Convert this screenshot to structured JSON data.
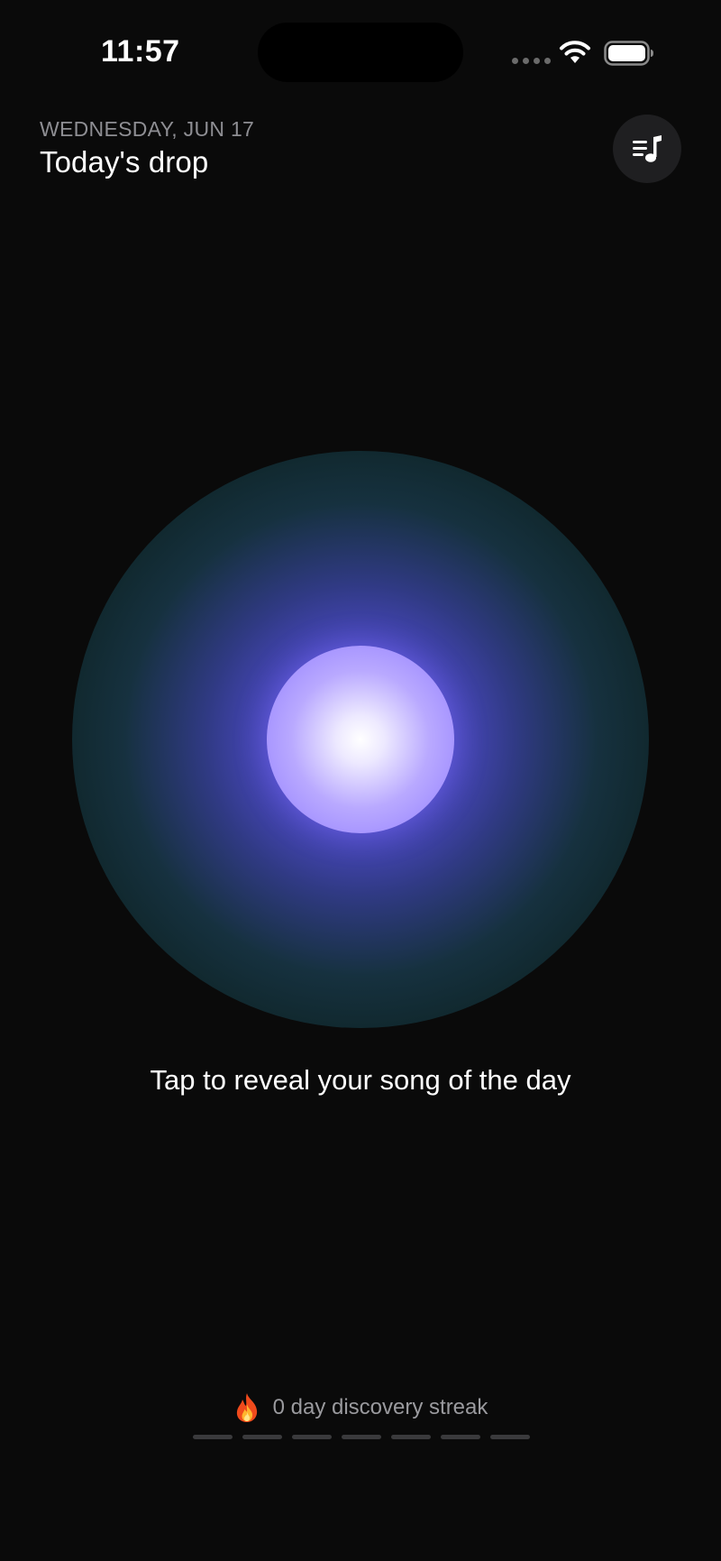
{
  "status_bar": {
    "time": "11:57",
    "icons": [
      "cellular-signal-icon",
      "wifi-icon",
      "battery-icon"
    ]
  },
  "header": {
    "date": "WEDNESDAY, JUN 17",
    "title": "Today's drop",
    "playlist_button_icon": "playlist-music-icon"
  },
  "orb": {
    "prompt": "Tap to reveal your song of the day",
    "colors": {
      "core": "#ffffff",
      "inner": "#8f7bff",
      "glow": "#5a56d8",
      "edge": "#0e2426"
    }
  },
  "streak": {
    "icon": "fire-icon",
    "text": "0 day discovery streak",
    "days_completed": 0,
    "days_total": 7
  },
  "colors": {
    "background": "#0a0a0a",
    "secondary_text": "#8e8e93",
    "button_bg": "#1f1f21",
    "streak_bar_inactive": "#3a3a3c"
  }
}
